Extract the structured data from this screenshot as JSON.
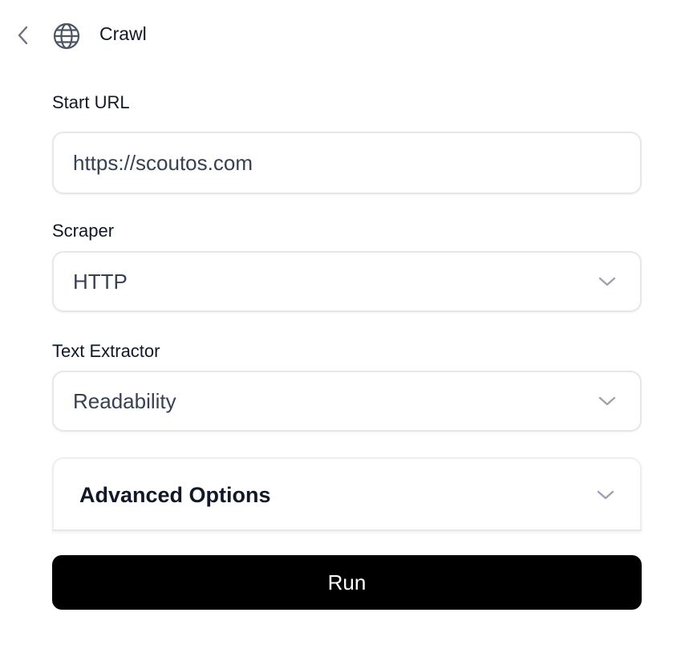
{
  "header": {
    "title": "Crawl",
    "back_icon": "chevron-left-icon",
    "app_icon": "globe-icon"
  },
  "form": {
    "start_url": {
      "label": "Start URL",
      "value": "https://scoutos.com"
    },
    "scraper": {
      "label": "Scraper",
      "value": "HTTP"
    },
    "text_extractor": {
      "label": "Text Extractor",
      "value": "Readability"
    },
    "advanced": {
      "label": "Advanced Options"
    },
    "run_label": "Run"
  },
  "colors": {
    "border": "#e5e7eb",
    "button_bg": "#000000",
    "button_text": "#ffffff",
    "chevron": "#9ca3af"
  }
}
